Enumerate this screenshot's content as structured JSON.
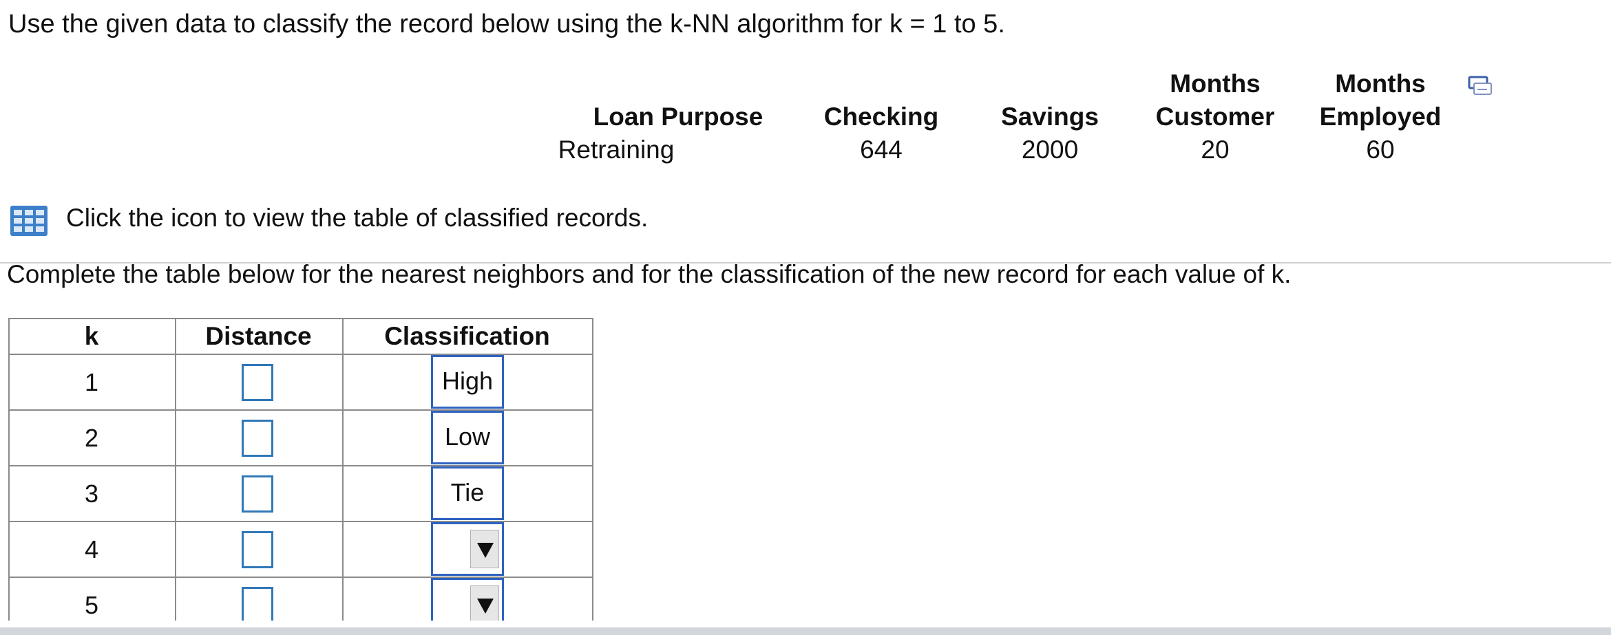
{
  "question": "Use the given data to classify the record below using the k-NN algorithm for k = 1 to 5.",
  "record": {
    "columns": [
      {
        "header_top": "",
        "header": "Loan Purpose",
        "value": "Retraining"
      },
      {
        "header_top": "",
        "header": "Checking",
        "value": "644"
      },
      {
        "header_top": "",
        "header": "Savings",
        "value": "2000"
      },
      {
        "header_top": "Months",
        "header": "Customer",
        "value": "20"
      },
      {
        "header_top": "Months",
        "header": "Employed",
        "value": "60"
      }
    ]
  },
  "icons": {
    "copy": "copy-icon",
    "table": "table-grid-icon"
  },
  "hint": "Click the icon to view the table of classified records.",
  "instruction": "Complete the table below for the nearest neighbors and for the classification of the new record for each value of k.",
  "answer_table": {
    "headers": [
      "k",
      "Distance",
      "Classification"
    ],
    "rows": [
      {
        "k": "1",
        "distance": "",
        "classification": "High",
        "dropdown": false
      },
      {
        "k": "2",
        "distance": "",
        "classification": "Low",
        "dropdown": false
      },
      {
        "k": "3",
        "distance": "",
        "classification": "Tie",
        "dropdown": false
      },
      {
        "k": "4",
        "distance": "",
        "classification": "",
        "dropdown": true
      },
      {
        "k": "5",
        "distance": "",
        "classification": "",
        "dropdown": true
      }
    ]
  },
  "colors": {
    "input_border": "#2f78b7",
    "select_border": "#2f63c0",
    "icon_blue": "#3d7fc9"
  }
}
